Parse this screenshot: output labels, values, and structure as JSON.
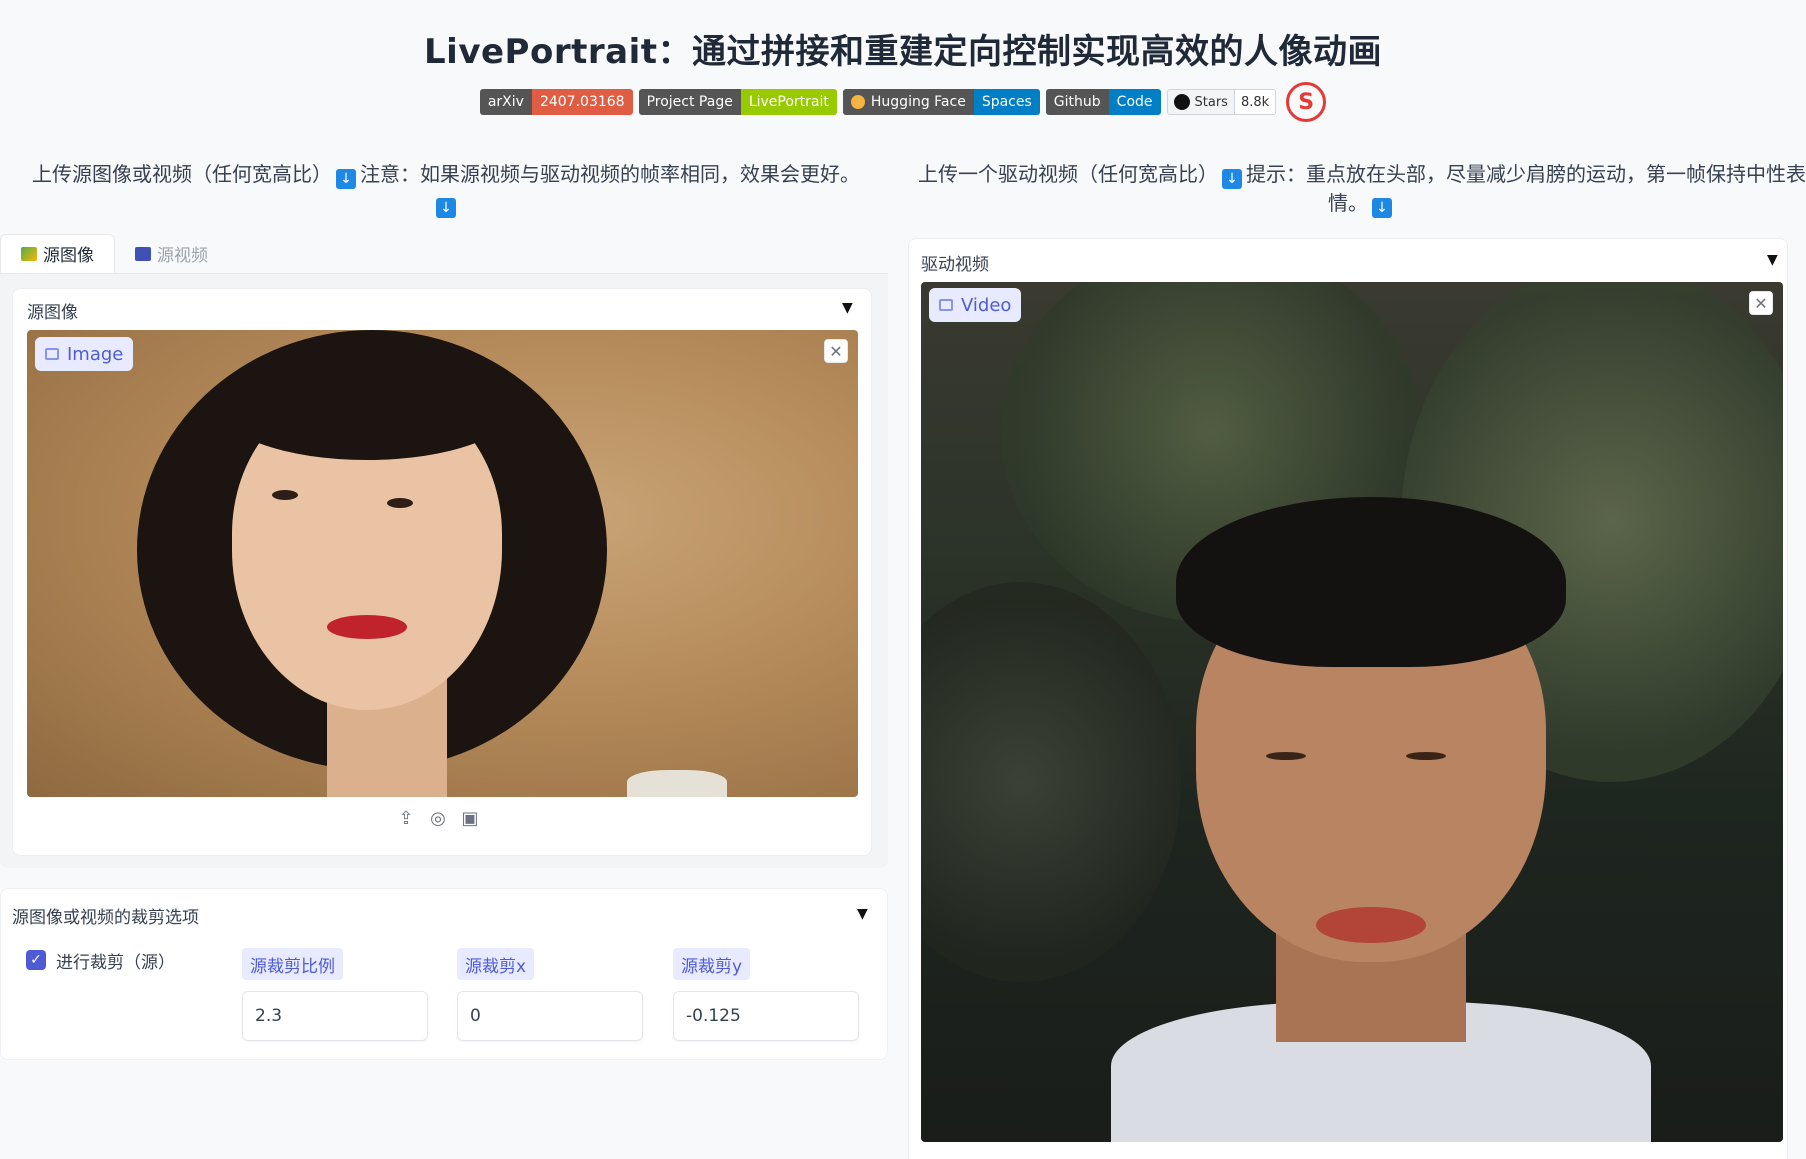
{
  "header": {
    "title": "LivePortrait：通过拼接和重建定向控制实现高效的人像动画",
    "badges": [
      {
        "left": "arXiv",
        "right": "2407.03168",
        "right_color": "#e05d44"
      },
      {
        "left": "Project Page",
        "right": "LivePortrait",
        "right_color": "#97ca00"
      },
      {
        "left": "Hugging Face",
        "right": "Spaces",
        "right_color": "#007ec6"
      },
      {
        "left": "Github",
        "right": "Code",
        "right_color": "#007ec6"
      }
    ],
    "stars": {
      "label": "Stars",
      "count": "8.8k"
    },
    "logo_icon": "red-s-logo-icon"
  },
  "instructions": {
    "left_main": "上传源图像或视频（任何宽高比）",
    "left_note": "注意：如果源视频与驱动视频的帧率相同，效果会更好。",
    "right_main": "上传一个驱动视频（任何宽高比）",
    "right_note": "提示：重点放在头部，尽量减少肩膀的运动，第一帧保持中性表情。"
  },
  "source": {
    "tabs": [
      {
        "label": "源图像",
        "icon": "image-icon",
        "active": true
      },
      {
        "label": "源视频",
        "icon": "film-icon",
        "active": false
      }
    ],
    "panel_label": "源图像",
    "chip_label": "Image",
    "tool_icons": [
      "upload-icon",
      "webcam-icon",
      "clipboard-icon"
    ]
  },
  "crop": {
    "panel_label": "源图像或视频的裁剪选项",
    "checkbox_label": "进行裁剪（源）",
    "checked": true,
    "fields": [
      {
        "label": "源裁剪比例",
        "value": "2.3"
      },
      {
        "label": "源裁剪x",
        "value": "0"
      },
      {
        "label": "源裁剪y",
        "value": "-0.125"
      }
    ]
  },
  "driving": {
    "panel_label": "驱动视频",
    "chip_label": "Video"
  },
  "colors": {
    "accent": "#4f5bd5",
    "download_icon": "#1e88e5"
  }
}
